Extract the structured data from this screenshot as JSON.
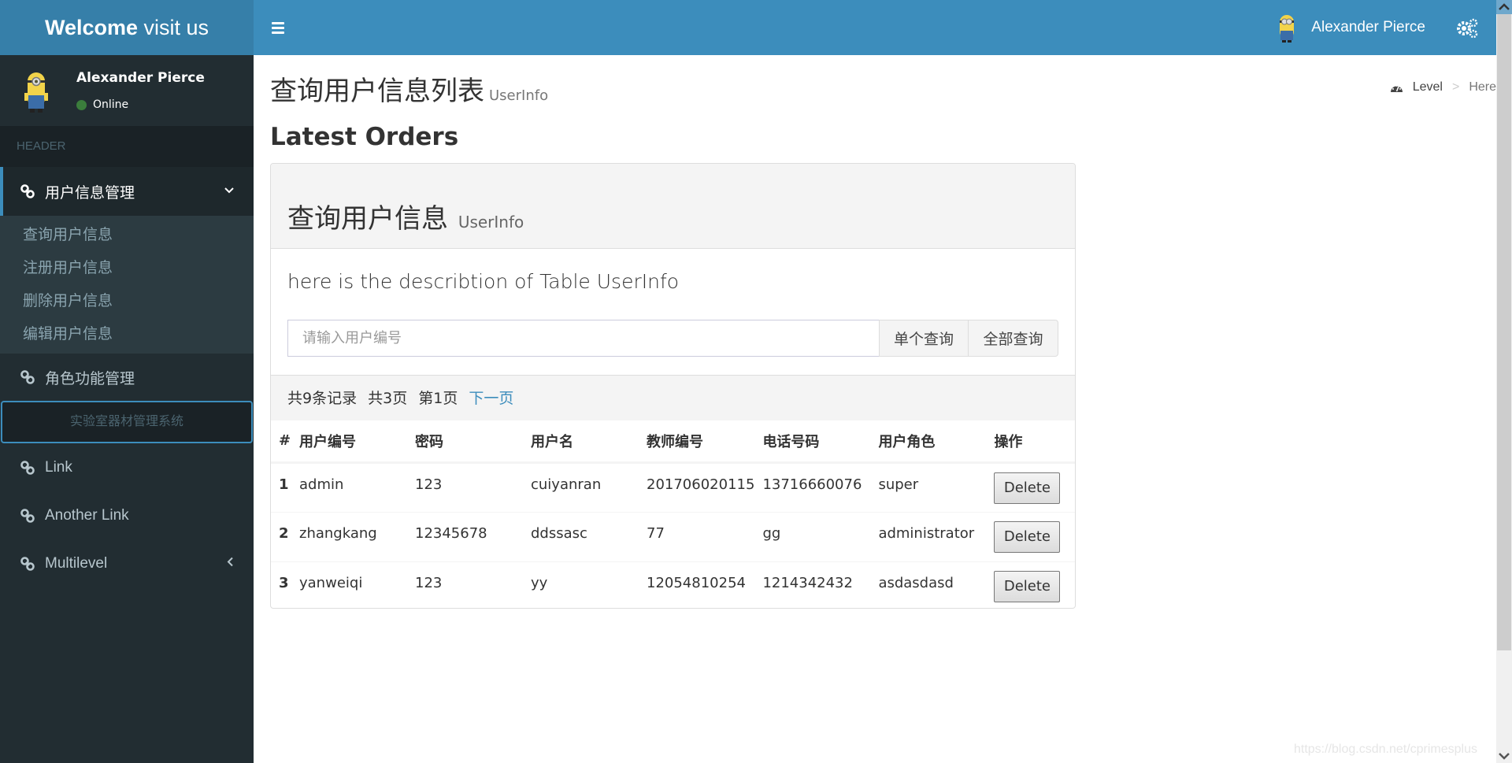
{
  "header": {
    "logo_bold": "Welcome",
    "logo_rest": " visit us",
    "user_name": "Alexander Pierce"
  },
  "sidebar": {
    "user": {
      "name": "Alexander Pierce",
      "status": "Online"
    },
    "section_header": "HEADER",
    "items": [
      {
        "label": "用户信息管理",
        "icon": "link-icon",
        "active": true,
        "expanded": true,
        "children": [
          "查询用户信息",
          "注册用户信息",
          "删除用户信息",
          "编辑用户信息"
        ]
      },
      {
        "label": "角色功能管理",
        "icon": "link-icon"
      }
    ],
    "search_text": "实验室器材管理系统",
    "links": [
      {
        "label": "Link",
        "icon": "link-icon"
      },
      {
        "label": "Another Link",
        "icon": "link-icon"
      },
      {
        "label": "Multilevel",
        "icon": "link-icon",
        "has_children": true
      }
    ]
  },
  "content": {
    "page_title": "查询用户信息列表",
    "page_subtitle": "UserInfo",
    "breadcrumb": {
      "level": "Level",
      "separator": ">",
      "here": "Here"
    },
    "section_title": "Latest Orders",
    "box": {
      "title": "查询用户信息",
      "title_small": "UserInfo",
      "description": "here is the describtion of Table UserInfo",
      "search_placeholder": "请输入用户编号",
      "search_value": "",
      "btn_single": "单个查询",
      "btn_all": "全部查询"
    },
    "pager": {
      "total_records": "共9条记录",
      "total_pages": "共3页",
      "current_page": "第1页",
      "next": "下一页"
    },
    "table": {
      "columns": [
        "#",
        "用户编号",
        "密码",
        "用户名",
        "教师编号",
        "电话号码",
        "用户角色",
        "操作"
      ],
      "rows": [
        {
          "idx": "1",
          "user_id": "admin",
          "password": "123",
          "username": "cuiyanran",
          "teacher_id": "201706020115",
          "phone": "13716660076",
          "role": "super",
          "action": "Delete"
        },
        {
          "idx": "2",
          "user_id": "zhangkang",
          "password": "12345678",
          "username": "ddssasc",
          "teacher_id": "77",
          "phone": "gg",
          "role": "administrator",
          "action": "Delete"
        },
        {
          "idx": "3",
          "user_id": "yanweiqi",
          "password": "123",
          "username": "yy",
          "teacher_id": "12054810254",
          "phone": "1214342432",
          "role": "asdasdasd",
          "action": "Delete"
        }
      ]
    }
  },
  "watermark": "https://blog.csdn.net/cprimesplus",
  "colors": {
    "navbar": "#3c8dbc",
    "logo_bg": "#367fa9",
    "sidebar": "#222d32",
    "link": "#3c8dbc",
    "online": "#3b7d3c"
  }
}
